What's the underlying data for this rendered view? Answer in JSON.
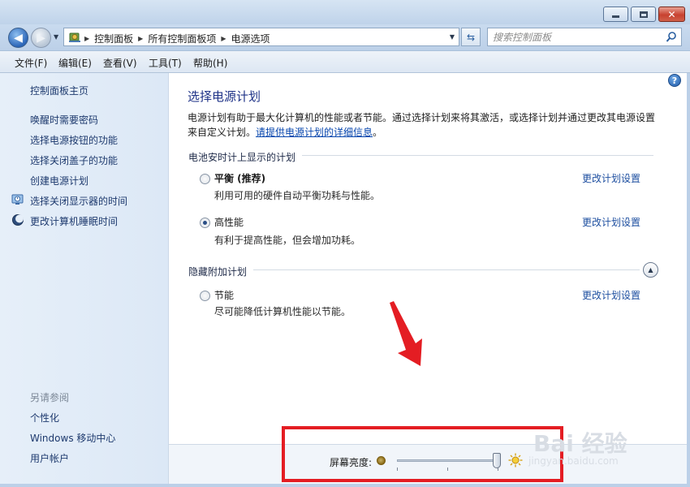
{
  "window": {
    "minimize_icon": "minimize-icon",
    "maximize_icon": "maximize-icon",
    "close_icon": "close-icon"
  },
  "address": {
    "crumbs": [
      "控制面板",
      "所有控制面板项",
      "电源选项"
    ],
    "search_placeholder": "搜索控制面板"
  },
  "menu": [
    "文件(F)",
    "编辑(E)",
    "查看(V)",
    "工具(T)",
    "帮助(H)"
  ],
  "sidebar": {
    "home": "控制面板主页",
    "items": [
      {
        "label": "唤醒时需要密码",
        "icon": ""
      },
      {
        "label": "选择电源按钮的功能",
        "icon": ""
      },
      {
        "label": "选择关闭盖子的功能",
        "icon": ""
      },
      {
        "label": "创建电源计划",
        "icon": ""
      },
      {
        "label": "选择关闭显示器的时间",
        "icon": "monitor-clock-icon"
      },
      {
        "label": "更改计算机睡眠时间",
        "icon": "moon-icon"
      }
    ],
    "see_also_title": "另请参阅",
    "see_also": [
      "个性化",
      "Windows 移动中心",
      "用户帐户"
    ]
  },
  "main": {
    "title": "选择电源计划",
    "intro": "电源计划有助于最大化计算机的性能或者节能。通过选择计划来将其激活，或选择计划并通过更改其电源设置来自定义计划。",
    "intro_link": "请提供电源计划的详细信息",
    "intro_end": "。",
    "group_battery": "电池安时计上显示的计划",
    "group_hidden": "隐藏附加计划",
    "plans": [
      {
        "name": "平衡 (推荐)",
        "desc": "利用可用的硬件自动平衡功耗与性能。",
        "selected": false,
        "change": "更改计划设置"
      },
      {
        "name": "高性能",
        "desc": "有利于提高性能，但会增加功耗。",
        "selected": true,
        "change": "更改计划设置"
      },
      {
        "name": "节能",
        "desc": "尽可能降低计算机性能以节能。",
        "selected": false,
        "change": "更改计划设置"
      }
    ]
  },
  "brightness": {
    "label": "屏幕亮度:",
    "level_percent": 98
  },
  "watermark": {
    "text": "Bai 经验",
    "url": "jingyan.baidu.com"
  },
  "colors": {
    "highlight_box": "#e41d23",
    "link": "#1e4fa0",
    "title": "#1e3287"
  }
}
